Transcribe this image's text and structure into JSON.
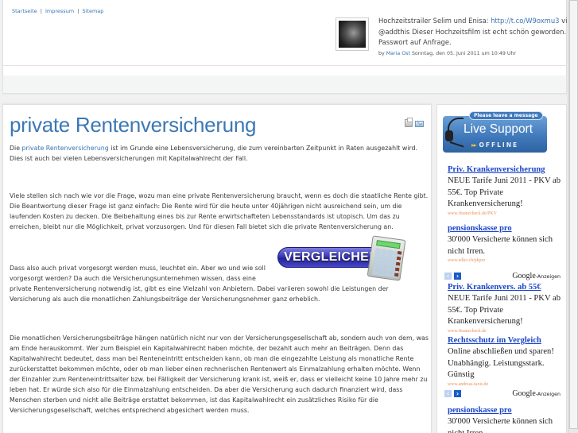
{
  "topnav": {
    "items": [
      "Startseite",
      "Impressum",
      "Sitemap"
    ],
    "separator": "|"
  },
  "tweet": {
    "text_before_link": "Hochzeitstrailer Selim und Enisa: ",
    "link": "http://t.co/W9oxmu3",
    "text_after_link": " via @addthis Dieser Hochzeitsfilm ist echt schön geworden. Passwort auf Anfrage.",
    "by_label": "by ",
    "author": "Maria Ost",
    "date": " Sonntag, den 05. Juni 2011 um 10:49 Uhr"
  },
  "article": {
    "title": "private Rentenversicherung",
    "p1_before": "Die ",
    "p1_link": "private Rentenversicherung",
    "p1_after": " ist im Grunde eine Lebensversicherung, die zum vereinbarten Zeitpunkt in Raten ausgezahlt wird. Dies ist auch bei vielen Lebensversicherungen mit Kapitalwahlrecht der Fall.",
    "p2": "Viele stellen sich nach wie vor die Frage, wozu man eine private Rentenversicherung braucht, wenn es doch die staatliche Rente gibt. Die Beantwortung dieser Frage ist ganz einfach: Die Rente wird für die heute unter 40jährigen nicht ausreichend sein, um die laufenden Kosten zu decken. Die Beibehaltung eines bis zur Rente erwirtschafteten Lebensstandards ist utopisch. Um das zu erreichen, bleibt nur die Möglichkeit, privat vorzusorgen. Und für diesen Fall bietet sich die private Rentenversicherung an.",
    "p3_narrow": "Dass also auch privat vorgesorgt werden muss, leuchtet ein. Aber wo und wie soll vorgesorgt werden? Da auch die Versicherungsunternehmen wissen, dass eine",
    "p3_rest": "private Rentenversicherung notwendig ist, gibt es eine Vielzahl von Anbietern. Dabei variieren sowohl die Leistungen der Versicherung als auch die monatlichen Zahlungsbeiträge der Versicherungsnehmer ganz erheblich.",
    "p4": "Die monatlichen Versicherungsbeiträge hängen natürlich nicht nur von der Versicherungsgesellschaft ab, sondern auch von dem, was am Ende herauskommt. Wer zum Beispiel ein Kapitalwahlrecht haben möchte, der bezahlt auch mehr an Beiträgen. Denn das Kapitalwahlrecht bedeutet, dass man bei Renteneintritt entscheiden kann, ob man die eingezahlte Leistung als monatliche Rente zurückerstattet bekommen möchte, oder ob man lieber einen rechnerischen Rentenwert als Einmalzahlung erhalten möchte. Wenn der Einzahler zum Renteneintrittsalter bzw. bei Fälligkeit der Versicherung krank ist, weiß er, dass er vielleicht keine 10 Jahre mehr zu leben hat. Er würde sich also für die Einmalzahlung entscheiden. Da aber die Versicherung auch dadurch finanziert wird, dass Menschen sterben und nicht alle Beiträge erstattet bekommen, ist das Kapitalwahlrecht ein zusätzliches Risiko für die Versicherungsgesellschaft, welches entsprechend abgesichert werden muss.",
    "compare_banner": "VERGLEICHEN",
    "icons": [
      "print-icon",
      "email-icon"
    ]
  },
  "sidebar": {
    "live_support": {
      "message": "Please leave a message",
      "title": "Live Support",
      "arrows": "▸▸",
      "status": "OFFLINE"
    },
    "ad_nav": {
      "prev": "‹",
      "next": "›",
      "google": "Google",
      "anzeigen": "-Anzeigen"
    },
    "ads_block1": [
      {
        "title": "Priv. Krankenversicherung",
        "body": "NEUE Tarife Juni 2011 - PKV ab 55€. Top Private Krankenversicherung!",
        "url": "www.finanzcheck.de/PKV"
      },
      {
        "title": "pensionskasse pro",
        "body": "30'000 Versicherte können sich nicht Irren.",
        "url": "www.telko.ch/pkpro"
      }
    ],
    "ads_block2": [
      {
        "title": "Priv. Krankenvers. ab 55€",
        "body": "NEUE Tarife Juni 2011 - PKV ab 55€. Top Private Krankenversicherung!",
        "url": "www.finanzcheck.de"
      },
      {
        "title": "Rechtsschutz im Vergleich",
        "body": "Online abschließen und sparen! Unabhängig. Leistungsstark. Günstig",
        "url": "www.andreas-taxis.de"
      }
    ],
    "ads_block3": [
      {
        "title": "pensionskasse pro",
        "body": "30'000 Versicherte können sich nicht Irren."
      }
    ]
  }
}
